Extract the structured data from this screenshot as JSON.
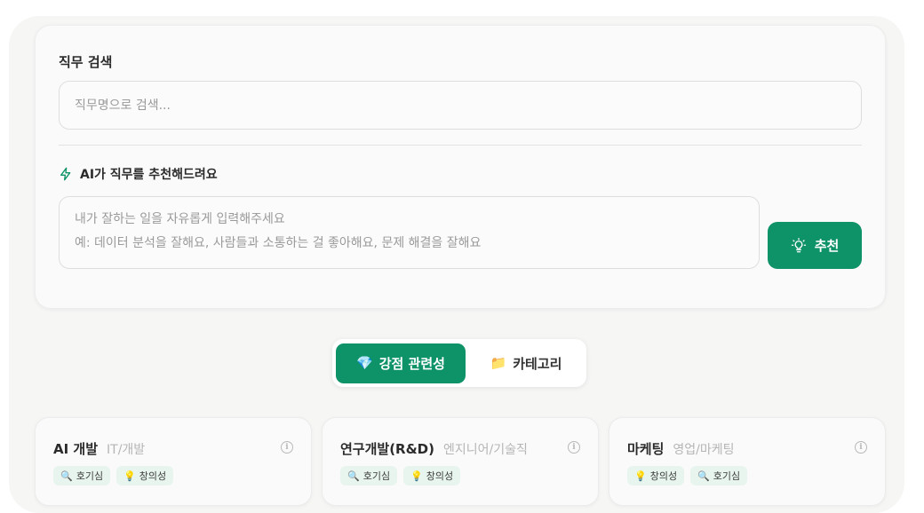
{
  "search": {
    "title": "직무 검색",
    "placeholder": "직무명으로 검색..."
  },
  "ai": {
    "title": "AI가 직무를 추천해드려요",
    "placeholder": "내가 잘하는 일을 자유롭게 입력해주세요\n예: 데이터 분석을 잘해요, 사람들과 소통하는 걸 좋아해요, 문제 해결을 잘해요",
    "button_label": "추천",
    "icon": "zap-icon",
    "button_icon": "lightbulb-icon"
  },
  "toggle": {
    "tabs": [
      {
        "label": "강점 관련성",
        "icon": "💎",
        "active": true
      },
      {
        "label": "카테고리",
        "icon": "📁",
        "active": false
      }
    ]
  },
  "jobs": [
    {
      "name": "AI 개발",
      "category": "IT/개발",
      "tags": [
        {
          "label": "호기심",
          "icon": "🔍"
        },
        {
          "label": "창의성",
          "icon": "💡"
        }
      ]
    },
    {
      "name": "연구개발(R&D)",
      "category": "엔지니어/기술직",
      "tags": [
        {
          "label": "호기심",
          "icon": "🔍"
        },
        {
          "label": "창의성",
          "icon": "💡"
        }
      ]
    },
    {
      "name": "마케팅",
      "category": "영업/마케팅",
      "tags": [
        {
          "label": "창의성",
          "icon": "💡"
        },
        {
          "label": "호기심",
          "icon": "🔍"
        }
      ]
    }
  ],
  "colors": {
    "accent": "#0e9268",
    "tag_bg": "#e8f5ef",
    "muted": "#b5b5b5"
  }
}
